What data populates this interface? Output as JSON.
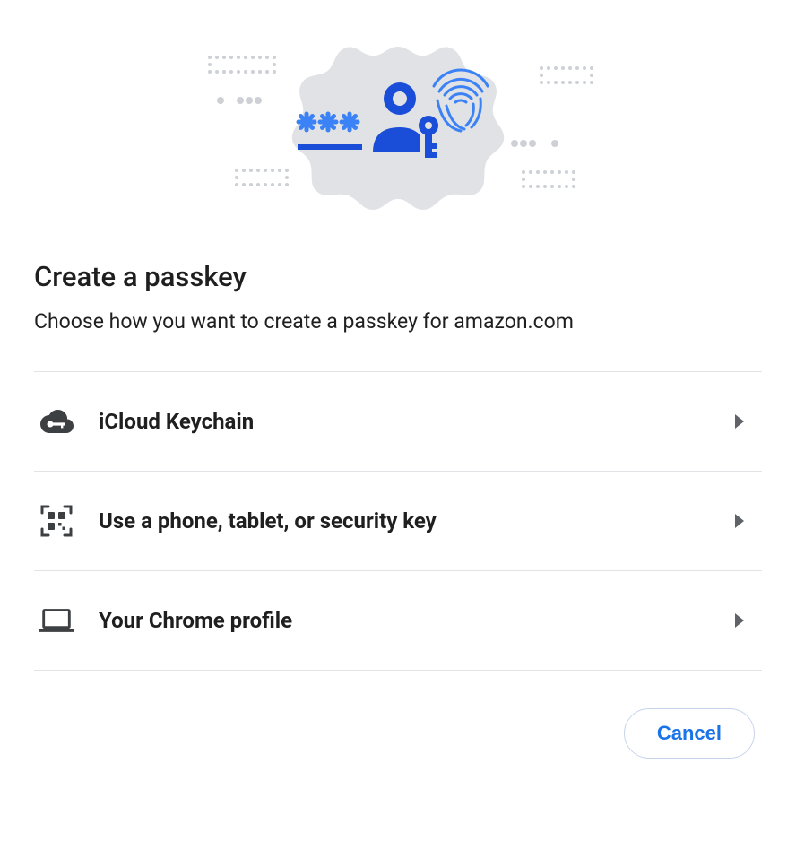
{
  "heading": "Create a passkey",
  "subheading": "Choose how you want to create a passkey for amazon.com",
  "options": [
    {
      "label": "iCloud Keychain",
      "icon": "cloud-key-icon"
    },
    {
      "label": "Use a phone, tablet, or security key",
      "icon": "qr-scan-icon"
    },
    {
      "label": "Your Chrome profile",
      "icon": "laptop-icon"
    }
  ],
  "cancel_label": "Cancel",
  "colors": {
    "accent_blue": "#1a73e8",
    "illustration_blue": "#1a4ed8",
    "illustration_light_blue": "#3b82f6",
    "gray_dot": "#cdd1d6",
    "option_icon": "#3c4043"
  }
}
